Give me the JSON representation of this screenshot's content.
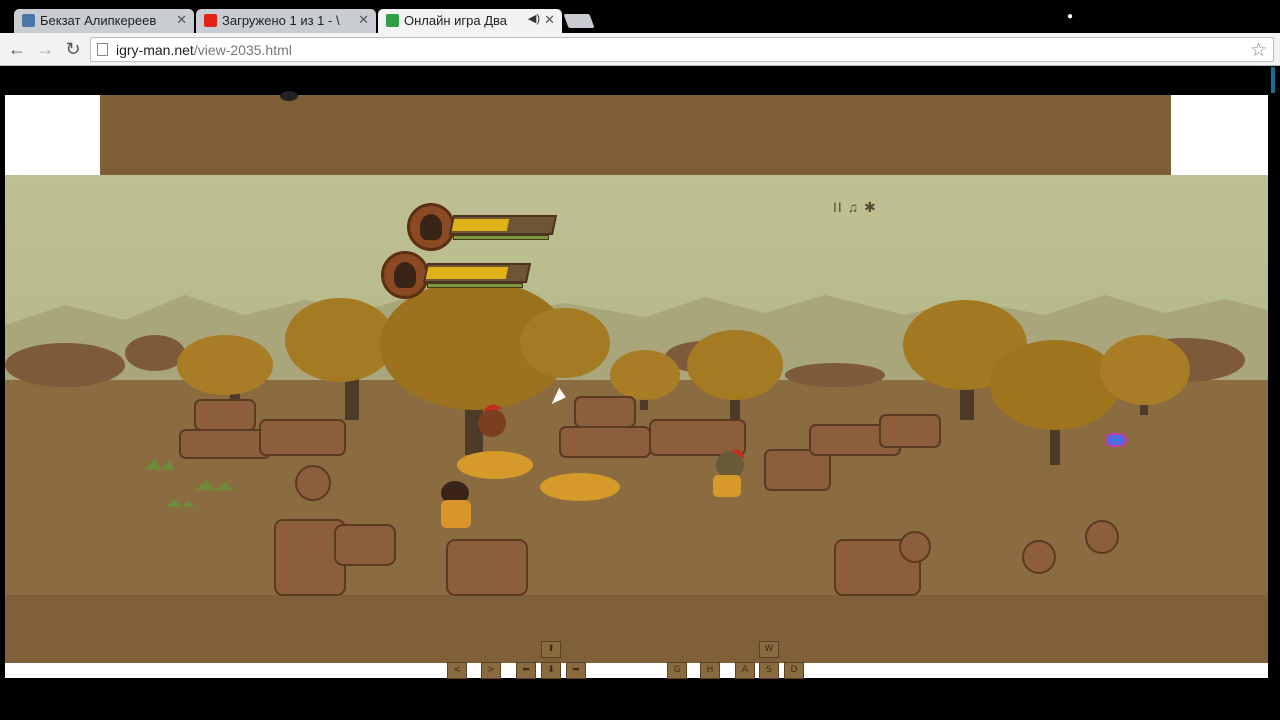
{
  "browser": {
    "tabs": [
      {
        "title": "Бекзат Алипкереев",
        "favicon_color": "#4a76a8",
        "active": false
      },
      {
        "title": "Загружено 1 из 1 - \\",
        "favicon_color": "#e62117",
        "active": false
      },
      {
        "title": "Онлайн игра Два",
        "favicon_color": "#2f9e44",
        "active": true
      }
    ],
    "close_glyph": "✕",
    "speaker_glyph": "◀)",
    "profile_glyph": "●",
    "nav": {
      "back": "←",
      "forward": "→",
      "reload": "↻"
    },
    "url_domain": "igry-man.net",
    "url_path": "/view-2035.html",
    "bookmark_star": "☆"
  },
  "game": {
    "controls_glyphs": "II ♫ ✱",
    "player1_health": 0.55,
    "player2_health": 0.8,
    "keys_arrows": {
      "up": "⬆",
      "left": "⬅",
      "down": "⬇",
      "right": "➡"
    },
    "keys_left_extra": [
      "<",
      ">"
    ],
    "keys_right": {
      "w": "W",
      "g": "G",
      "h": "H",
      "a": "A",
      "s": "S",
      "d": "D"
    }
  },
  "colors": {
    "ground": "#8c6c42",
    "sky": "#bfc194",
    "health": "#e0b21a",
    "banner": "#7e5e36"
  }
}
